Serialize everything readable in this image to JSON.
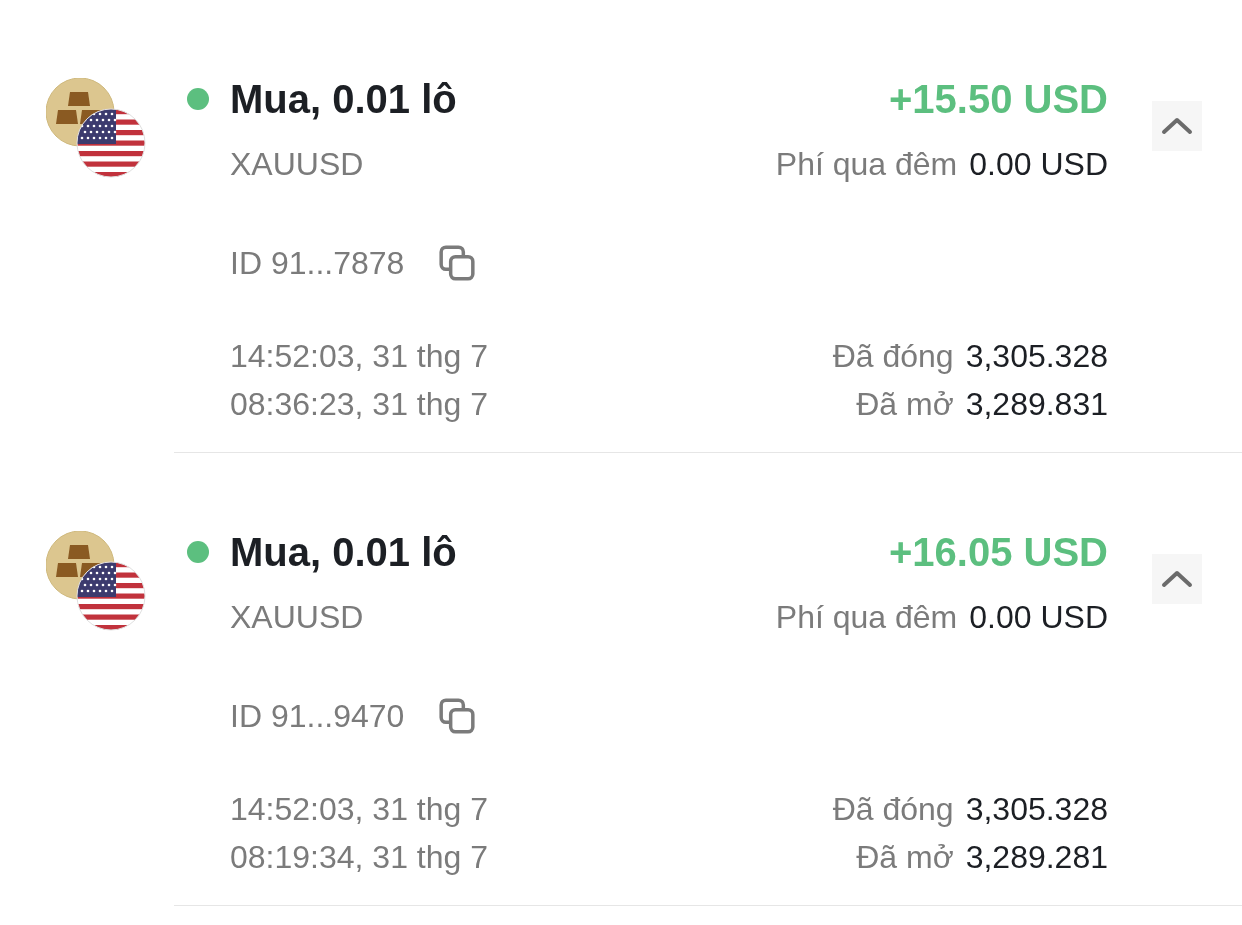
{
  "positions": [
    {
      "color": "#5cbf7f",
      "title": "Mua, 0.01 lô",
      "symbol": "XAUUSD",
      "profit": "+15.50 USD",
      "fee_label": "Phí qua đêm",
      "fee_value": "0.00 USD",
      "id": "ID 91...7878",
      "closed_time": "14:52:03, 31 thg 7",
      "opened_time": "08:36:23, 31 thg 7",
      "closed_label": "Đã đóng",
      "closed_price": "3,305.328",
      "opened_label": "Đã mở",
      "opened_price": "3,289.831",
      "expanded": true
    },
    {
      "color": "#5cbf7f",
      "title": "Mua, 0.01 lô",
      "symbol": "XAUUSD",
      "profit": "+16.05 USD",
      "fee_label": "Phí qua đêm",
      "fee_value": "0.00 USD",
      "id": "ID 91...9470",
      "closed_time": "14:52:03, 31 thg 7",
      "opened_time": "08:19:34, 31 thg 7",
      "closed_label": "Đã đóng",
      "closed_price": "3,305.328",
      "opened_label": "Đã mở",
      "opened_price": "3,289.281",
      "expanded": true
    }
  ]
}
